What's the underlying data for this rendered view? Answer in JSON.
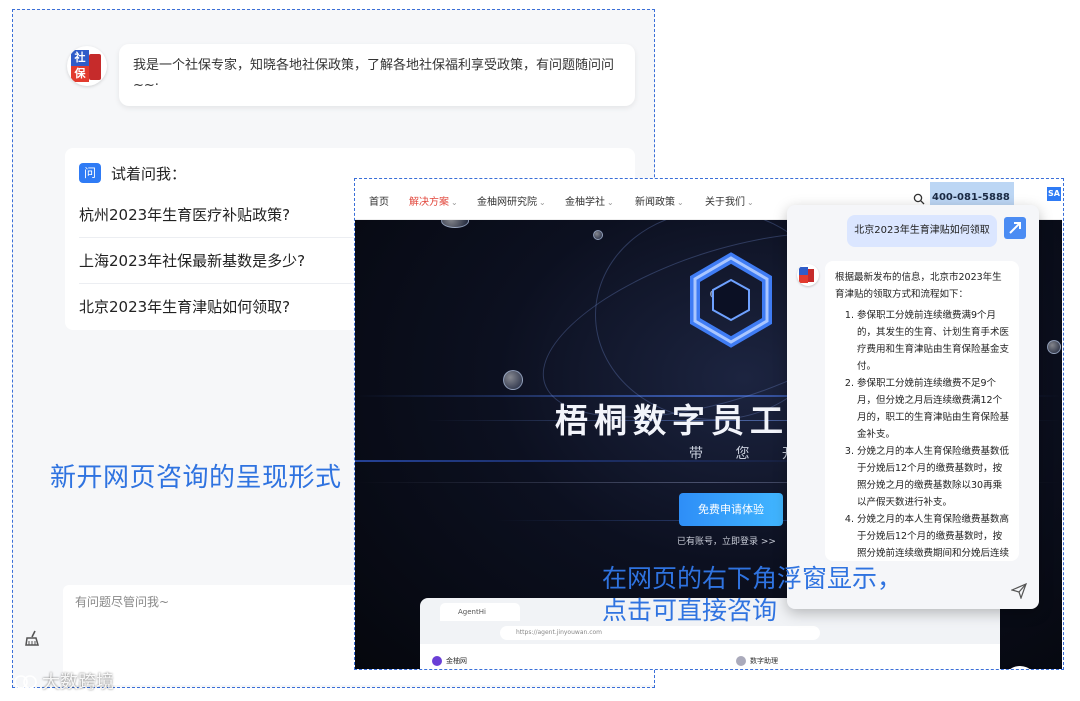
{
  "left": {
    "greeting": "我是一个社保专家，知晓各地社保政策，了解各地社保福利享受政策，有问题随问问~~·",
    "avatar_top": "社",
    "avatar_bottom": "保",
    "suggest_icon": "问",
    "suggest_title": "试着问我：",
    "questions": [
      "杭州2023年生育医疗补贴政策?",
      "上海2023年社保最新基数是多少?",
      "北京2023年生育津贴如何领取?"
    ],
    "input_placeholder": "有问题尽管问我~",
    "caption": "新开网页咨询的呈现形式",
    "icons": {
      "clear": "broom-icon"
    }
  },
  "right": {
    "nav": [
      {
        "label": "首页",
        "dropdown": false,
        "active": false
      },
      {
        "label": "解决方案",
        "dropdown": true,
        "active": true
      },
      {
        "label": "金柚网研究院",
        "dropdown": true,
        "active": false
      },
      {
        "label": "金柚学社",
        "dropdown": true,
        "active": false
      },
      {
        "label": "新闻政策",
        "dropdown": true,
        "active": false
      },
      {
        "label": "关于我们",
        "dropdown": true,
        "active": false
      }
    ],
    "phone": "400-081-5888",
    "corner_logo": "SA",
    "hero_title": "梧桐数字员工",
    "hero_subtitle": "带 您 开 _",
    "trial_button": "免费申请体验",
    "login_text": "已有账号，立即登录 >>",
    "mini_browser": {
      "tab_label": "AgentHi",
      "address": "https://agent.jinyouwan.com",
      "sidebar_label": "金柚网",
      "center_label": "数字助理"
    },
    "chat": {
      "user_question": "北京2023年生育津贴如何领取",
      "answer_intro": "根据最新发布的信息，北京市2023年生育津贴的领取方式和流程如下：",
      "answer_items": [
        "参保职工分娩前连续缴费满9个月的，其发生的生育、计划生育手术医疗费用和生育津贴由生育保险基金支付。",
        "参保职工分娩前连续缴费不足9个月，但分娩之月后连续缴费满12个月的，职工的生育津贴由生育保险基金补支。",
        "分娩之月的本人生育保险缴费基数低于分娩后12个月的缴费基数时，按照分娩之月的缴费基数除以30再乘以产假天数进行补支。",
        "分娩之月的本人生育保险缴费基数高于分娩后12个月的缴费基数时，按照分娩前连续缴费期间和分娩后连续缴费期间的平均缴费基数计"
      ]
    },
    "caption_line1": "在网页的右下角浮窗显示，",
    "caption_line2": "点击可直接咨询",
    "colors": {
      "accent": "#2f73e0",
      "active_nav": "#e2463b",
      "button": "#2e8ef7"
    }
  },
  "watermark": "大数跨境"
}
